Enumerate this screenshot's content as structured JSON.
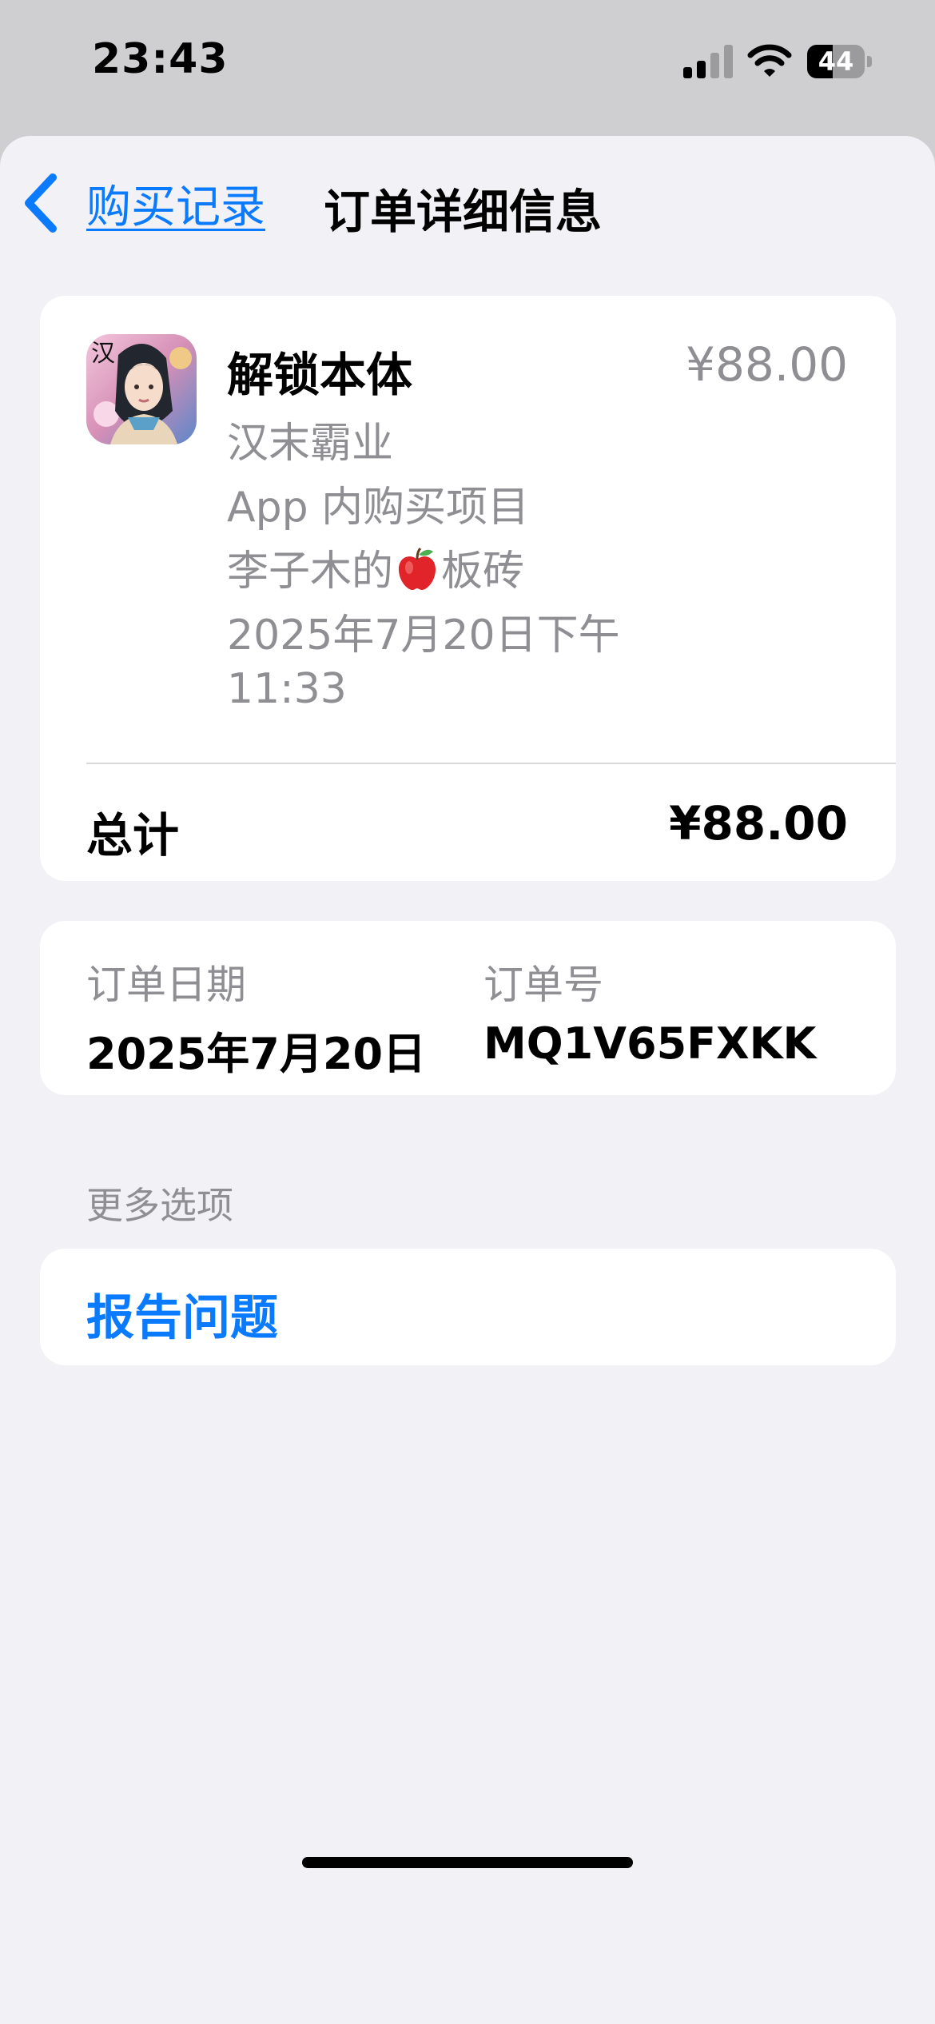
{
  "status_bar": {
    "time": "23:43",
    "battery_level": "44",
    "signal_bars": 2,
    "signal_icon": "cellular-signal-icon",
    "wifi_icon": "wifi-icon",
    "battery_icon": "battery-icon"
  },
  "nav": {
    "back_label": "购买记录",
    "back_icon": "chevron-left-icon",
    "title": "订单详细信息"
  },
  "item": {
    "icon": "app-icon-han-mo-ba-ye",
    "title": "解锁本体",
    "price": "¥88.00",
    "app_name": "汉末霸业",
    "type": "App 内购买项目",
    "device_prefix": "李子木的",
    "device_emoji": "🍎",
    "device_suffix": "板砖",
    "date_line1": "2025年7月20日下午",
    "date_line2": "11:33"
  },
  "total": {
    "label": "总计",
    "value": "¥88.00"
  },
  "order": {
    "date_label": "订单日期",
    "date_value": "2025年7月20日",
    "number_label": "订单号",
    "number_value": "MQ1V65FXKK"
  },
  "more_options": {
    "header": "更多选项",
    "report_label": "报告问题"
  },
  "colors": {
    "accent": "#0a7aff",
    "secondary_text": "#8e8e93",
    "background": "#f2f1f6"
  }
}
